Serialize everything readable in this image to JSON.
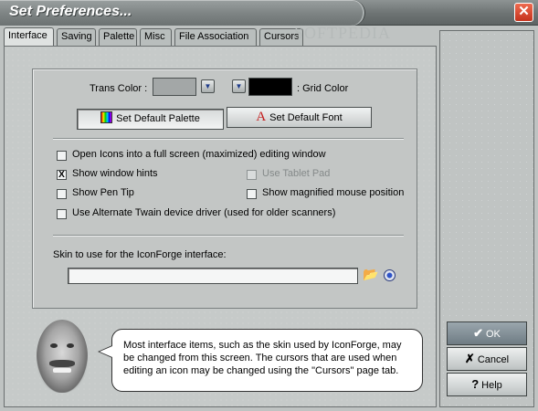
{
  "window": {
    "title": "Set Preferences...",
    "close_label": "✕",
    "watermark": "SOFTPEDIA"
  },
  "tabs": [
    {
      "label": "Interface",
      "active": true
    },
    {
      "label": "Saving",
      "active": false
    },
    {
      "label": "Palette",
      "active": false
    },
    {
      "label": "Misc",
      "active": false
    },
    {
      "label": "File Association",
      "active": false
    },
    {
      "label": "Cursors",
      "active": false
    }
  ],
  "colors": {
    "trans_color_label": "Trans Color :",
    "trans_color_value": "#a3a7a7",
    "grid_color_label": ": Grid Color",
    "grid_color_value": "#000000"
  },
  "buttons": {
    "default_palette": "Set Default Palette",
    "default_font": "Set Default Font"
  },
  "options": {
    "open_fullscreen": {
      "label": "Open Icons into a full screen (maximized) editing window",
      "checked": false
    },
    "show_window_hints": {
      "label": "Show window hints",
      "checked": true
    },
    "use_tablet_pad": {
      "label": "Use Tablet Pad",
      "checked": false,
      "disabled": true
    },
    "show_pen_tip": {
      "label": "Show Pen Tip",
      "checked": false
    },
    "show_magnified": {
      "label": "Show magnified mouse position",
      "checked": false
    },
    "alt_twain": {
      "label": "Use Alternate Twain device driver (used for older scanners)",
      "checked": false
    }
  },
  "skin": {
    "label": "Skin to use for the IconForge interface:",
    "value": ""
  },
  "help_bubble": {
    "text": "Most interface items, such as the skin used by IconForge, may be changed from this screen. The cursors that are used when editing an icon may be changed using the \"Cursors\" page tab."
  },
  "side_buttons": {
    "ok": "OK",
    "cancel": "Cancel",
    "help": "Help"
  }
}
